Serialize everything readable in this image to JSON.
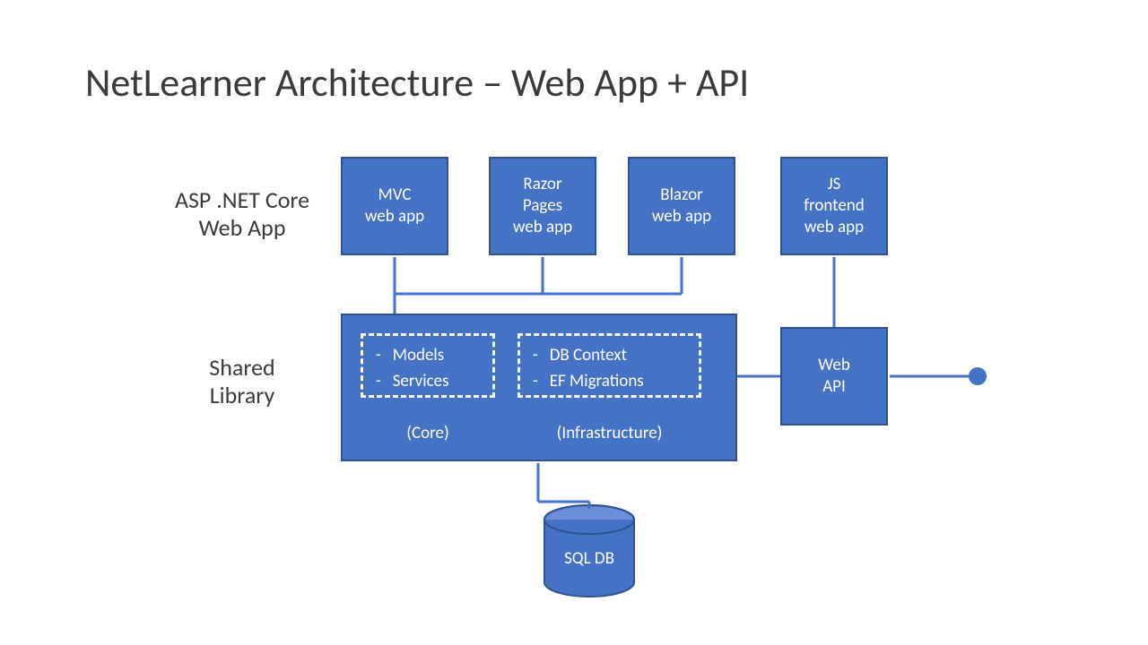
{
  "title": "NetLearner Architecture – Web App + API",
  "rowLabels": {
    "topLine1": "ASP .NET Core",
    "topLine2": "Web App",
    "midLine1": "Shared",
    "midLine2": "Library"
  },
  "boxes": {
    "mvc": {
      "line1": "MVC",
      "line2": "web app"
    },
    "razor": {
      "line1": "Razor",
      "line2": "Pages",
      "line3": "web app"
    },
    "blazor": {
      "line1": "Blazor",
      "line2": "web app"
    },
    "jsfe": {
      "line1": "JS",
      "line2": "frontend",
      "line3": "web app"
    },
    "webapi": {
      "line1": "Web",
      "line2": "API"
    }
  },
  "shared": {
    "core": {
      "item1": "Models",
      "item2": "Services",
      "caption": "(Core)"
    },
    "infra": {
      "item1": "DB Context",
      "item2": "EF Migrations",
      "caption": "(Infrastructure)"
    }
  },
  "db": {
    "label": "SQL DB"
  },
  "colors": {
    "boxFill": "#4472C4",
    "boxBorder": "#2F528F",
    "text": "#3a3a3a"
  }
}
